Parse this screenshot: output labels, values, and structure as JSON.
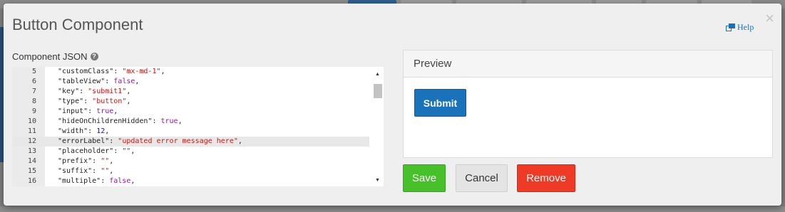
{
  "dialog": {
    "title": "Button Component",
    "help_label": "Help",
    "close_glyph": "×"
  },
  "editor": {
    "label": "Component JSON",
    "label_help_glyph": "?",
    "lines": [
      {
        "n": "5",
        "parts": [
          [
            "p",
            "\"customClass\": "
          ],
          [
            "s",
            "\"mx-md-1\""
          ],
          [
            "p",
            ","
          ]
        ]
      },
      {
        "n": "6",
        "parts": [
          [
            "p",
            "\"tableView\": "
          ],
          [
            "k",
            "false"
          ],
          [
            "p",
            ","
          ]
        ]
      },
      {
        "n": "7",
        "parts": [
          [
            "p",
            "\"key\": "
          ],
          [
            "s",
            "\"submit1\""
          ],
          [
            "p",
            ","
          ]
        ]
      },
      {
        "n": "8",
        "parts": [
          [
            "p",
            "\"type\": "
          ],
          [
            "s",
            "\"button\""
          ],
          [
            "p",
            ","
          ]
        ]
      },
      {
        "n": "9",
        "parts": [
          [
            "p",
            "\"input\": "
          ],
          [
            "k",
            "true"
          ],
          [
            "p",
            ","
          ]
        ]
      },
      {
        "n": "10",
        "parts": [
          [
            "p",
            "\"hideOnChildrenHidden\": "
          ],
          [
            "k",
            "true"
          ],
          [
            "p",
            ","
          ]
        ]
      },
      {
        "n": "11",
        "parts": [
          [
            "p",
            "\"width\": "
          ],
          [
            "n",
            "12"
          ],
          [
            "p",
            ","
          ]
        ]
      },
      {
        "n": "12",
        "parts": [
          [
            "p",
            "\"errorLabel\": "
          ],
          [
            "s",
            "\"updated error message here\""
          ],
          [
            "p",
            ","
          ]
        ],
        "active": true
      },
      {
        "n": "13",
        "parts": [
          [
            "p",
            "\"placeholder\": "
          ],
          [
            "s",
            "\"\""
          ],
          [
            "p",
            ","
          ]
        ]
      },
      {
        "n": "14",
        "parts": [
          [
            "p",
            "\"prefix\": "
          ],
          [
            "s",
            "\"\""
          ],
          [
            "p",
            ","
          ]
        ]
      },
      {
        "n": "15",
        "parts": [
          [
            "p",
            "\"suffix\": "
          ],
          [
            "s",
            "\"\""
          ],
          [
            "p",
            ","
          ]
        ]
      },
      {
        "n": "16",
        "parts": [
          [
            "p",
            "\"multiple\": "
          ],
          [
            "k",
            "false"
          ],
          [
            "p",
            ","
          ]
        ]
      }
    ]
  },
  "preview": {
    "title": "Preview",
    "submit_label": "Submit"
  },
  "actions": {
    "save": "Save",
    "cancel": "Cancel",
    "remove": "Remove"
  },
  "colors": {
    "save": "#47c129",
    "remove": "#ef3b25",
    "submit": "#1a73ba",
    "link": "#1a70b7"
  },
  "icons": {
    "help": "external-window-icon",
    "label_help": "question-circle-icon",
    "close": "close-icon"
  }
}
